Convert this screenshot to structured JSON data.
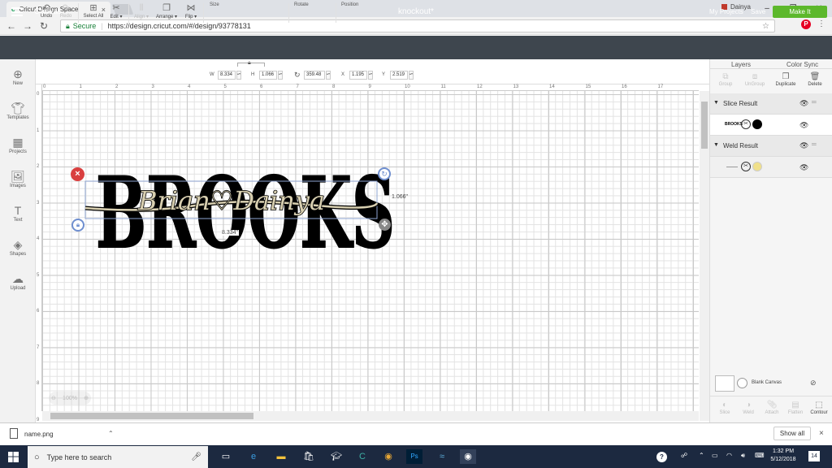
{
  "browser": {
    "tab_title": "Cricut Design Space",
    "profile_name": "Dainya",
    "url_secure": "Secure",
    "url": "https://design.cricut.com/#/design/93778131"
  },
  "app": {
    "section": "Canvas",
    "project_title": "knockout*",
    "my_projects": "My Projects",
    "save": "Save",
    "make_it": "Make It"
  },
  "toolbar": {
    "undo": "Undo",
    "redo": "Redo",
    "select_all": "Select All",
    "edit": "Edit ▾",
    "align": "Align ▾",
    "arrange": "Arrange ▾",
    "flip": "Flip ▾",
    "size_label": "Size",
    "w_label": "W",
    "w_value": "8.334",
    "h_label": "H",
    "h_value": "1.066",
    "rotate_label": "Rotate",
    "rotate_value": "359.48",
    "position_label": "Position",
    "x_label": "X",
    "x_value": "1.195",
    "y_label": "Y",
    "y_value": "2.519"
  },
  "leftbar": [
    "New",
    "Templates",
    "Projects",
    "Images",
    "Text",
    "Shapes",
    "Upload"
  ],
  "ruler": {
    "top": [
      "0",
      "1",
      "2",
      "3",
      "4",
      "5",
      "6",
      "7",
      "8",
      "9",
      "10",
      "11",
      "12",
      "13",
      "14",
      "15",
      "16",
      "17"
    ],
    "left": [
      "0",
      "1",
      "2",
      "3",
      "4",
      "5",
      "6",
      "7",
      "8",
      "9"
    ]
  },
  "design": {
    "knockout_text": "BROOKS",
    "script_text": "Brian♡Dainya",
    "width_dim": "8.334\"",
    "height_dim": "1.066\"",
    "zoom": "100%"
  },
  "rightpanel": {
    "tab_layers": "Layers",
    "tab_color_sync": "Color Sync",
    "buttons": [
      "Group",
      "UnGroup",
      "Duplicate",
      "Delete"
    ],
    "group1": "Slice Result",
    "group1_thumb": "BROOKS",
    "group2": "Weld Result",
    "blank_canvas": "Blank Canvas",
    "bottom_buttons": [
      "Slice",
      "Weld",
      "Attach",
      "Flatten",
      "Contour"
    ]
  },
  "download": {
    "file": "name.png",
    "show_all": "Show all"
  },
  "taskbar": {
    "search": "Type here to search",
    "time": "1:32 PM",
    "date": "5/12/2018",
    "notifications": "14"
  },
  "colors": {
    "make_it": "#5cb82c",
    "header": "#3e464e",
    "script_fill": "#d8cfb0"
  }
}
